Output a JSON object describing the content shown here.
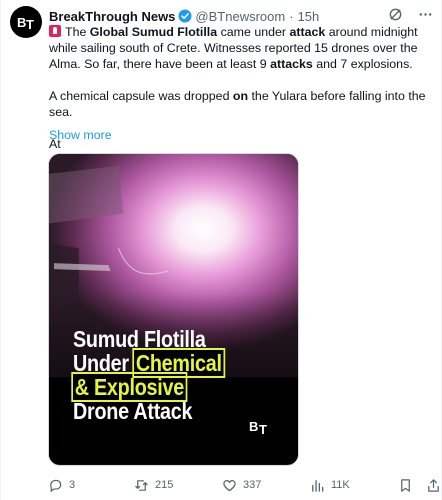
{
  "tweet": {
    "author_name": "BreakThrough News",
    "handle": "@BTnewsroom",
    "separator": "·",
    "time": "15h",
    "paragraph1": [
      {
        "t": "The ",
        "b": false
      },
      {
        "t": "Global Sumud Flotilla",
        "b": true
      },
      {
        "t": " came under ",
        "b": false
      },
      {
        "t": "attack",
        "b": true
      },
      {
        "t": " around midnight while sailing south of Crete. Witnesses reported 15 drones over the Alma. So far, there have been at least 9 ",
        "b": false
      },
      {
        "t": "attacks",
        "b": true
      },
      {
        "t": " and 7 explosions.",
        "b": false
      }
    ],
    "paragraph2": [
      {
        "t": "A chemical capsule was dropped ",
        "b": false
      },
      {
        "t": "on",
        "b": true
      },
      {
        "t": " the Yulara before falling into the sea.",
        "b": false
      }
    ],
    "paragraph3": "At",
    "show_more": "Show more"
  },
  "media": {
    "line1": "Sumud Flotilla",
    "line2_prefix": "Under ",
    "line2_highlight": "Chemical",
    "line3": "& Explosive",
    "line4": "Drone Attack"
  },
  "actions": {
    "replies": "3",
    "reposts": "215",
    "likes": "337",
    "views": "11K"
  },
  "colors": {
    "accent": "#1d9bf0",
    "highlight": "#e6f43a",
    "muted": "#536471"
  }
}
